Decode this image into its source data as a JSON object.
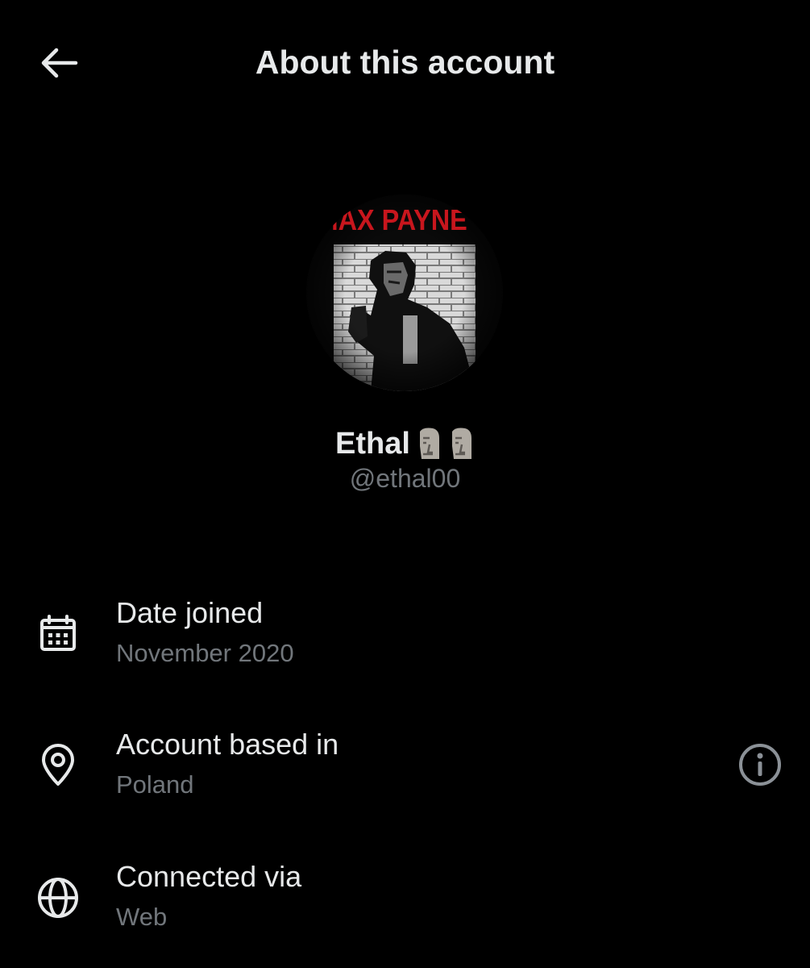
{
  "header": {
    "title": "About this account",
    "back_icon": "arrow-left-icon"
  },
  "profile": {
    "display_name": "Ethal",
    "name_emoji": [
      "moai-icon",
      "moai-icon"
    ],
    "handle": "@ethal00",
    "avatar_text": "MAX PAYNE"
  },
  "details": {
    "date_joined": {
      "label": "Date joined",
      "value": "November 2020",
      "icon": "calendar-icon"
    },
    "account_based_in": {
      "label": "Account based in",
      "value": "Poland",
      "icon": "location-pin-icon",
      "info_icon": "info-icon"
    },
    "connected_via": {
      "label": "Connected via",
      "value": "Web",
      "icon": "globe-icon"
    }
  },
  "colors": {
    "background": "#000000",
    "primary_text": "#e7e9ea",
    "secondary_text": "#71767b",
    "avatar_title_red": "#c8161d"
  }
}
